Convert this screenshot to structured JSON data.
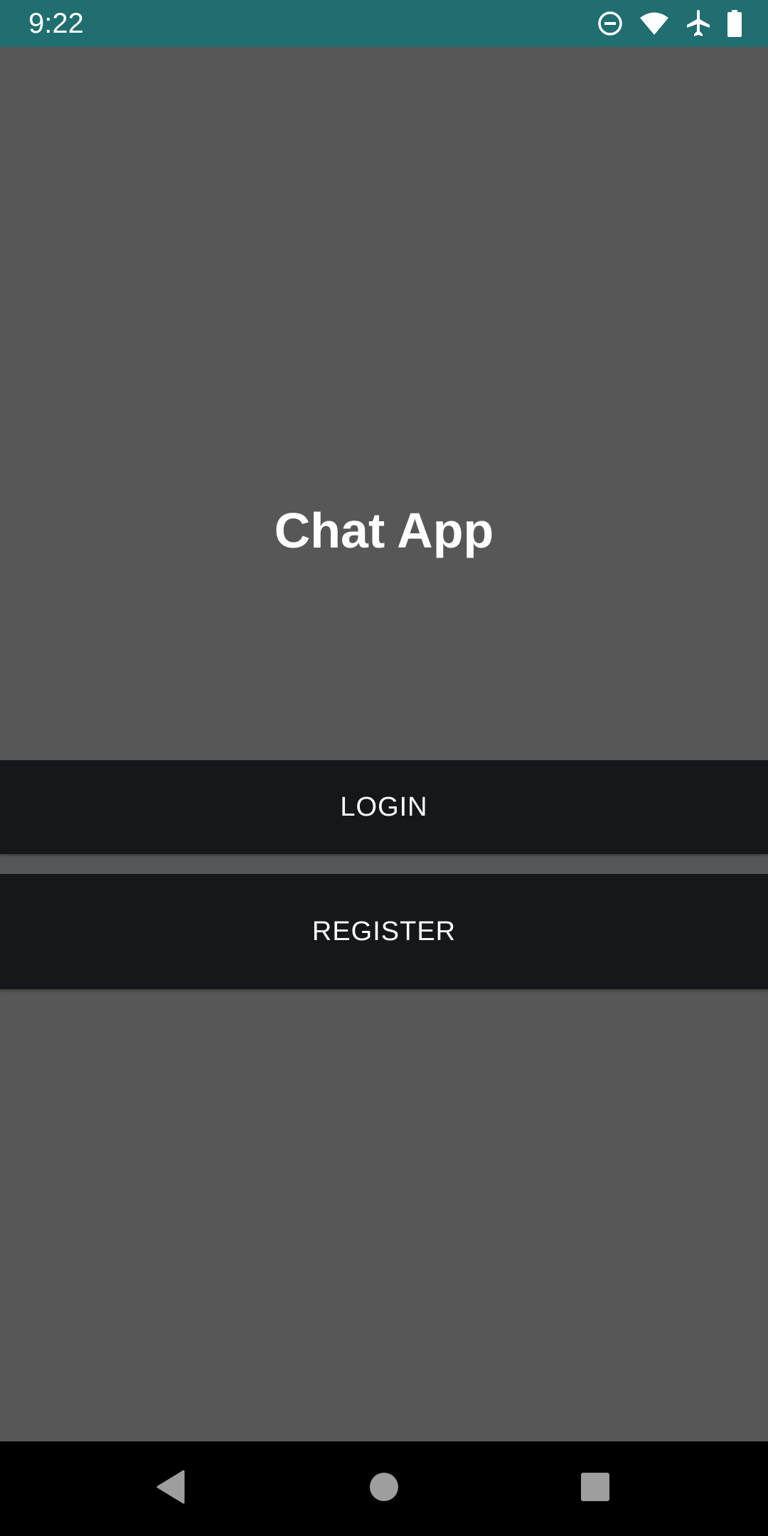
{
  "status_bar": {
    "time": "9:22",
    "background": "#206e6f",
    "icons": [
      "do-not-disturb-icon",
      "wifi-icon",
      "airplane-mode-icon",
      "battery-icon"
    ]
  },
  "main": {
    "title": "Chat App",
    "background": "#575757"
  },
  "buttons": {
    "login_label": "LOGIN",
    "register_label": "REGISTER",
    "background": "#15181b"
  },
  "nav_bar": {
    "icons": [
      "back-icon",
      "home-icon",
      "recents-icon"
    ]
  }
}
